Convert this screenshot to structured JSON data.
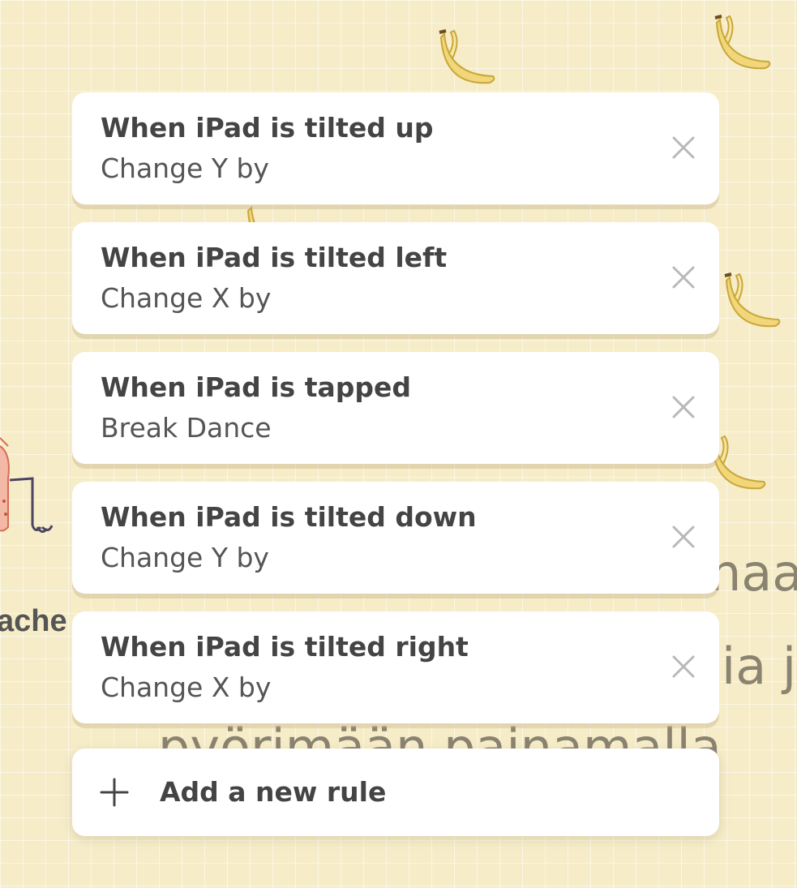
{
  "rules": [
    {
      "trigger": "When iPad is tilted up",
      "action": "Change Y by"
    },
    {
      "trigger": "When iPad is tilted left",
      "action": "Change X by"
    },
    {
      "trigger": "When iPad is tapped",
      "action": "Break Dance"
    },
    {
      "trigger": "When iPad is tilted down",
      "action": "Change Y by"
    },
    {
      "trigger": "When iPad is tilted right",
      "action": "Change X by"
    }
  ],
  "add_rule_label": "Add a new rule",
  "background": {
    "text_line_1": "naa",
    "text_line_2": "ia j",
    "text_line_3": "pyörimään painamalla",
    "character_label": "ache"
  },
  "icons": {
    "close": "close-icon",
    "add": "plus-icon",
    "decor": "banana-icon"
  },
  "colors": {
    "card": "#ffffff",
    "background": "#f6ecc8",
    "text": "#444444",
    "icon": "#b8b8b8"
  }
}
